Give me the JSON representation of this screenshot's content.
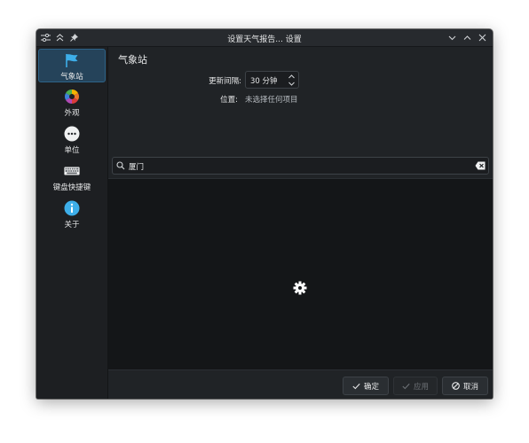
{
  "window": {
    "title": "设置天气报告... 设置"
  },
  "sidebar": {
    "items": [
      {
        "label": "气象站",
        "icon": "flag-icon",
        "active": true
      },
      {
        "label": "外观",
        "icon": "color-wheel-icon",
        "active": false
      },
      {
        "label": "单位",
        "icon": "more-dots-icon",
        "active": false
      },
      {
        "label": "键盘快捷键",
        "icon": "keyboard-icon",
        "active": false
      },
      {
        "label": "关于",
        "icon": "info-icon",
        "active": false
      }
    ]
  },
  "page": {
    "title": "气象站",
    "interval_label": "更新间隔:",
    "interval_value": "30 分钟",
    "location_label": "位置:",
    "location_value": "未选择任何项目",
    "search_value": "厦门"
  },
  "footer": {
    "ok": "确定",
    "apply": "应用",
    "cancel": "取消"
  },
  "colors": {
    "accent": "#3daee9",
    "active_bg": "#25435a",
    "window_bg": "#202326",
    "results_bg": "#141618"
  }
}
